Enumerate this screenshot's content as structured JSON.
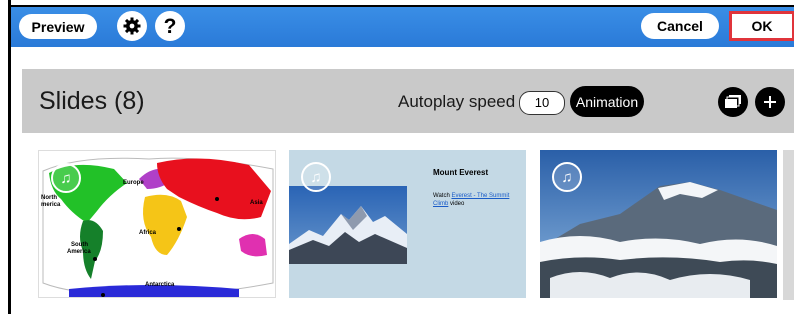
{
  "toolbar": {
    "preview_label": "Preview",
    "settings_icon": "gear-icon",
    "help_icon": "question-icon",
    "cancel_label": "Cancel",
    "ok_label": "OK",
    "accent_color": "#2a7ad8",
    "ok_border_color": "#e0343b"
  },
  "slides_panel": {
    "title": "Slides (8)",
    "autoplay_label": "Autoplay speed",
    "autoplay_value": "10",
    "animation_label": "Animation",
    "gallery_icon": "gallery-icon",
    "add_icon": "plus-icon"
  },
  "slides": [
    {
      "kind": "map",
      "labels": {
        "north_america": "North\nmerica",
        "europe": "Europe",
        "asia": "Asia",
        "africa": "Africa",
        "south_america": "South\nAmerica",
        "antarctica": "Antarctica"
      }
    },
    {
      "kind": "text-image",
      "heading": "Mount Everest",
      "watch_prefix": "Watch ",
      "link_text": "Everest - The Summit Climb",
      "watch_suffix": " video"
    },
    {
      "kind": "photo"
    }
  ]
}
